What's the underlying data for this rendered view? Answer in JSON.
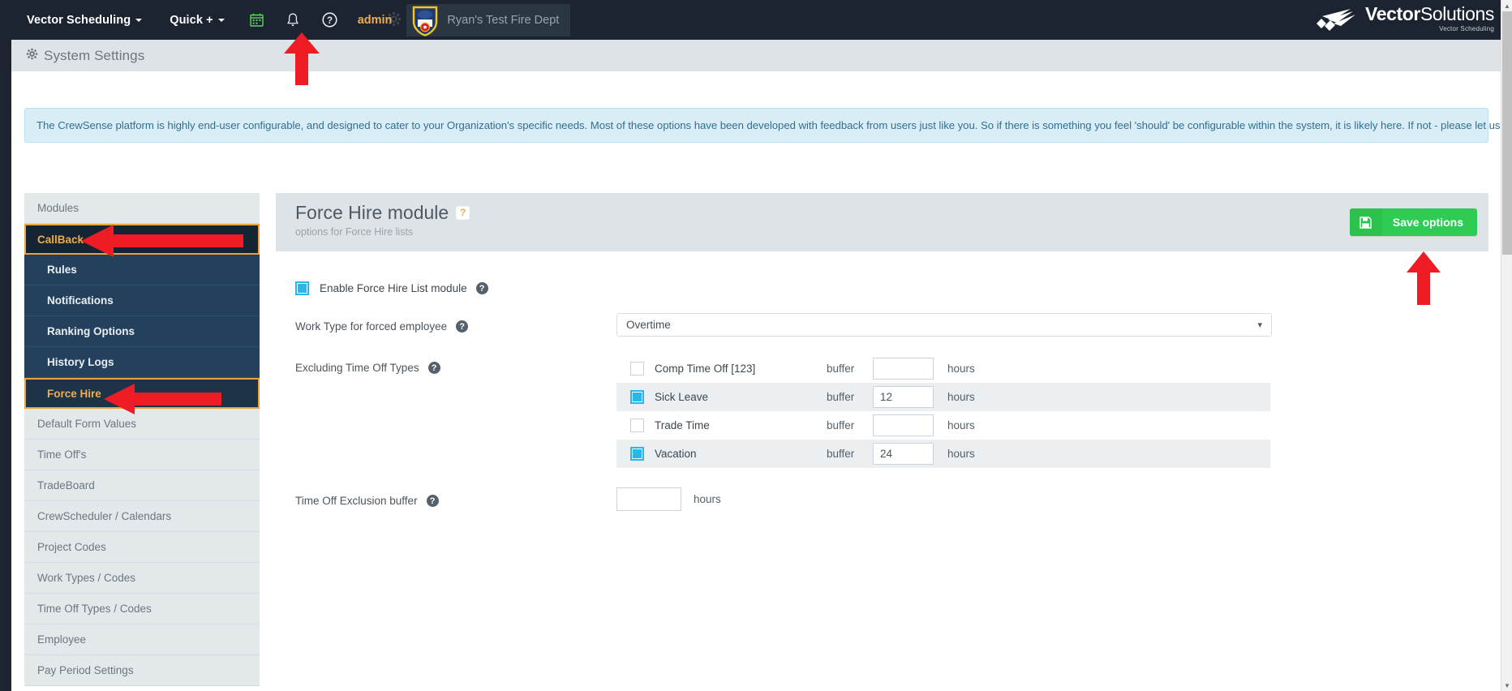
{
  "navbar": {
    "brand_menu": "Vector Scheduling",
    "quick_menu": "Quick +",
    "calendar_icon": "calendar-icon",
    "bell_icon": "bell-icon",
    "help_icon": "help-circle-icon",
    "admin_link": "admin",
    "gear_icon": "gear-icon",
    "department": "Ryan's Test Fire Dept",
    "logo_word_bold": "Vector",
    "logo_word_light": "Solutions",
    "logo_sub": "Vector Scheduling"
  },
  "page": {
    "title": "System Settings",
    "gear_icon": "gear-icon"
  },
  "alert": {
    "text": "The CrewSense platform is highly end-user configurable, and designed to cater to your Organization's specific needs. Most of these options have been developed with feedback from users just like you. So if there is something you feel 'should' be configurable within the system, it is likely here. If not - please let us know!"
  },
  "sidebar": {
    "items": [
      {
        "label": "Modules",
        "style": "header"
      },
      {
        "label": "CallBack",
        "style": "active-parent"
      },
      {
        "label": "Rules",
        "style": "child"
      },
      {
        "label": "Notifications",
        "style": "child"
      },
      {
        "label": "Ranking Options",
        "style": "child"
      },
      {
        "label": "History Logs",
        "style": "child"
      },
      {
        "label": "Force Hire",
        "style": "active-child"
      },
      {
        "label": "Default Form Values",
        "style": "plain"
      },
      {
        "label": "Time Off's",
        "style": "plain"
      },
      {
        "label": "TradeBoard",
        "style": "plain"
      },
      {
        "label": "CrewScheduler / Calendars",
        "style": "plain"
      },
      {
        "label": "Project Codes",
        "style": "plain"
      },
      {
        "label": "Work Types / Codes",
        "style": "plain"
      },
      {
        "label": "Time Off Types / Codes",
        "style": "plain"
      },
      {
        "label": "Employee",
        "style": "plain"
      },
      {
        "label": "Pay Period Settings",
        "style": "plain"
      }
    ]
  },
  "panel": {
    "title": "Force Hire module",
    "title_help": "?",
    "subtitle": "options for Force Hire lists",
    "save_label": "Save options",
    "save_icon": "floppy-disk-icon"
  },
  "form": {
    "enable_module": {
      "label": "Enable Force Hire List module",
      "checked": true,
      "help": "?"
    },
    "work_type": {
      "label": "Work Type for forced employee",
      "help": "?",
      "value": "Overtime",
      "chevron": "chevron-down-icon"
    },
    "excluding_time_off_types": {
      "label": "Excluding Time Off Types",
      "help": "?",
      "buffer_word": "buffer",
      "hours_word": "hours",
      "rows": [
        {
          "name": "Comp Time Off [123]",
          "checked": false,
          "buffer": ""
        },
        {
          "name": "Sick Leave",
          "checked": true,
          "buffer": "12"
        },
        {
          "name": "Trade Time",
          "checked": false,
          "buffer": ""
        },
        {
          "name": "Vacation",
          "checked": true,
          "buffer": "24"
        }
      ]
    },
    "time_off_exclusion_buffer": {
      "label": "Time Off Exclusion buffer",
      "help": "?",
      "value": "",
      "hours_word": "hours"
    }
  },
  "colors": {
    "navbar": "#1b2430",
    "accent_orange": "#f0ad4e",
    "save_green": "#2ecc55",
    "checkbox_blue": "#29b6e8",
    "sidebar_dark": "#23405c",
    "annotation_red": "#ee1c25"
  }
}
